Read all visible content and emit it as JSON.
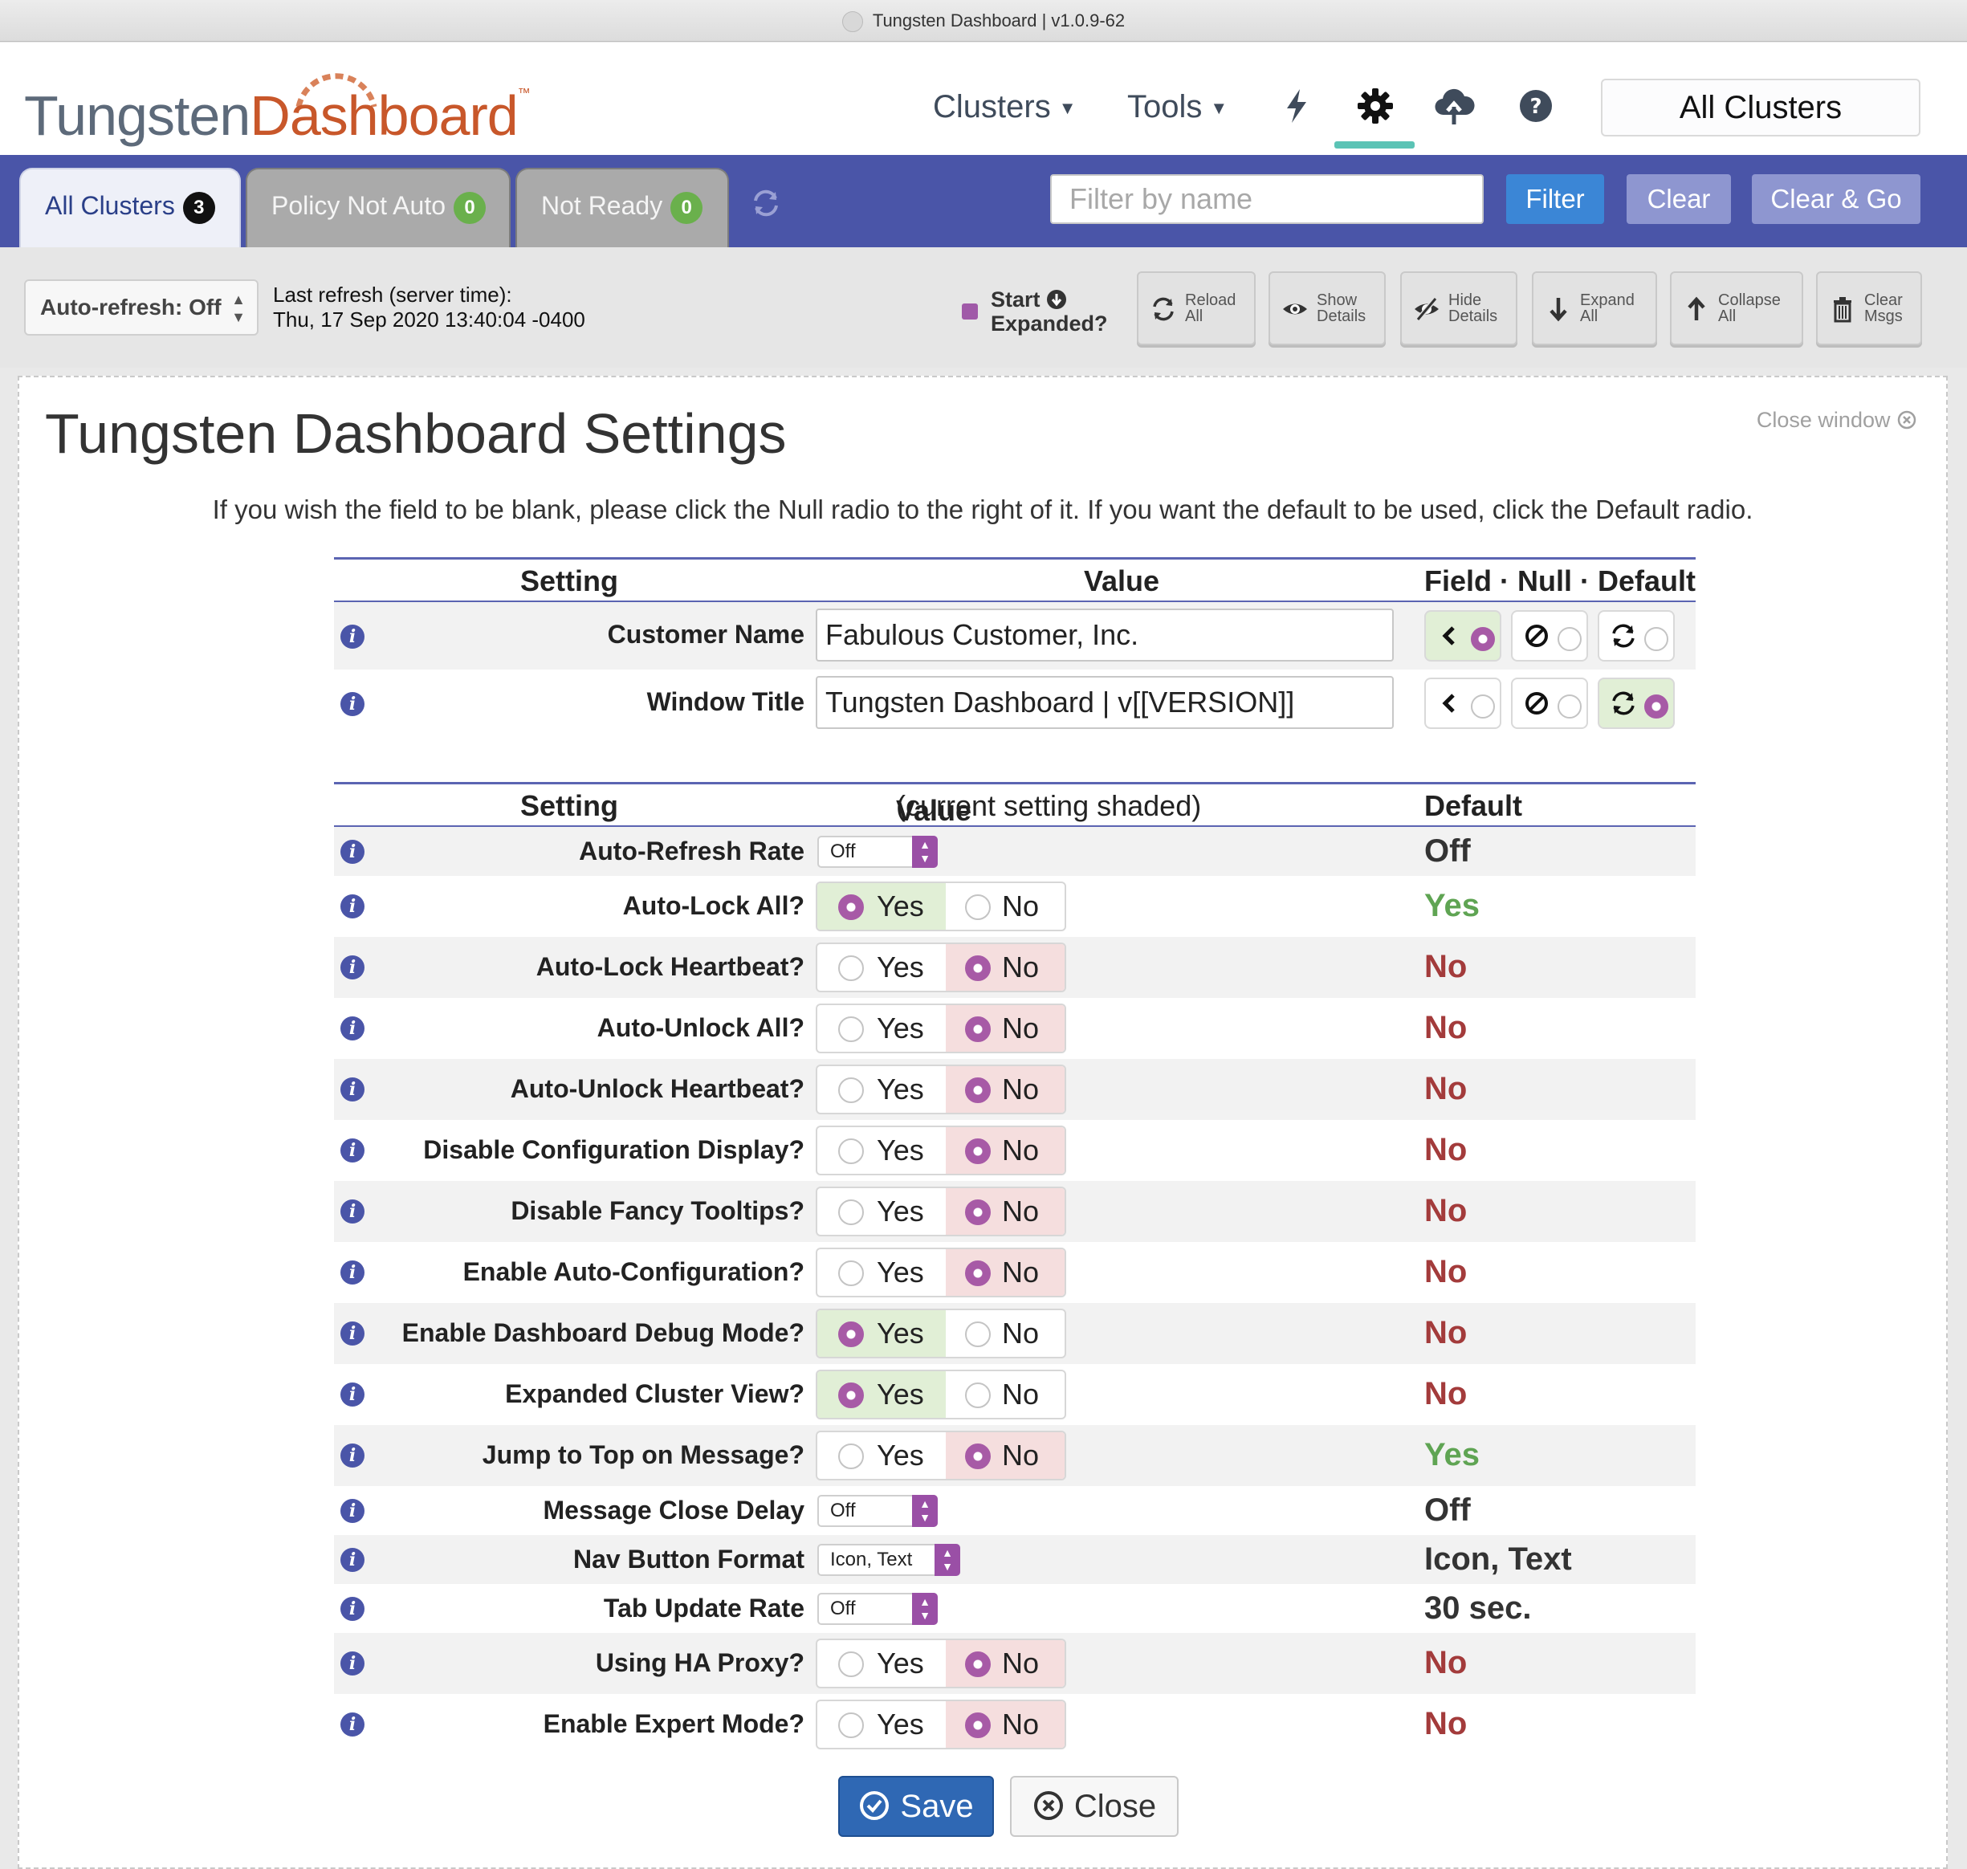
{
  "window": {
    "title": "Tungsten Dashboard | v1.0.9-62"
  },
  "header": {
    "logo_part1": "Tungsten",
    "logo_part2": "Dashboard",
    "logo_tm": "™",
    "nav": {
      "clusters": "Clusters",
      "tools": "Tools"
    },
    "icons": [
      "bolt-icon",
      "gear-icon",
      "cloud-upload-icon",
      "help-icon"
    ],
    "cluster_select": "All Clusters"
  },
  "tabs": [
    {
      "label": "All Clusters",
      "count": "3",
      "active": true
    },
    {
      "label": "Policy Not Auto",
      "count": "0",
      "active": false
    },
    {
      "label": "Not Ready",
      "count": "0",
      "active": false
    }
  ],
  "filter": {
    "placeholder": "Filter by name",
    "filter_label": "Filter",
    "clear_label": "Clear",
    "clear_go_label": "Clear & Go"
  },
  "toolbar": {
    "autorefresh": "Auto-refresh: Off",
    "last_refresh_label": "Last refresh (server time):",
    "last_refresh_value": "Thu, 17 Sep 2020 13:40:04 -0400",
    "start_expanded_1": "Start",
    "start_expanded_2": "Expanded?",
    "buttons": [
      {
        "l1": "Reload",
        "l2": "All"
      },
      {
        "l1": "Show",
        "l2": "Details"
      },
      {
        "l1": "Hide",
        "l2": "Details"
      },
      {
        "l1": "Expand",
        "l2": "All"
      },
      {
        "l1": "Collapse",
        "l2": "All"
      },
      {
        "l1": "Clear",
        "l2": "Msgs"
      }
    ]
  },
  "settings": {
    "title": "Tungsten Dashboard Settings",
    "close_window": "Close window",
    "instructions": "If you wish the field to be blank, please click the Null radio to the right of it. If you want the default to be used, click the Default radio.",
    "table1": {
      "h_setting": "Setting",
      "h_value": "Value",
      "h_fnd": "Field · Null · Default",
      "rows": [
        {
          "label": "Customer Name",
          "value": "Fabulous Customer, Inc.",
          "selected": "field"
        },
        {
          "label": "Window Title",
          "value": "Tungsten Dashboard | v[[VERSION]]",
          "selected": "default"
        }
      ]
    },
    "table2": {
      "h_setting": "Setting",
      "h_value": "Value",
      "h_value_note": " (current setting shaded)",
      "h_default": "Default",
      "rows": [
        {
          "label": "Auto-Refresh Rate",
          "type": "select",
          "value": "Off",
          "default": "Off"
        },
        {
          "label": "Auto-Lock All?",
          "type": "yn",
          "value": "Yes",
          "default": "Yes"
        },
        {
          "label": "Auto-Lock Heartbeat?",
          "type": "yn",
          "value": "No",
          "default": "No"
        },
        {
          "label": "Auto-Unlock All?",
          "type": "yn",
          "value": "No",
          "default": "No"
        },
        {
          "label": "Auto-Unlock Heartbeat?",
          "type": "yn",
          "value": "No",
          "default": "No"
        },
        {
          "label": "Disable Configuration Display?",
          "type": "yn",
          "value": "No",
          "default": "No"
        },
        {
          "label": "Disable Fancy Tooltips?",
          "type": "yn",
          "value": "No",
          "default": "No"
        },
        {
          "label": "Enable Auto-Configuration?",
          "type": "yn",
          "value": "No",
          "default": "No"
        },
        {
          "label": "Enable Dashboard Debug Mode?",
          "type": "yn",
          "value": "Yes",
          "default": "No"
        },
        {
          "label": "Expanded Cluster View?",
          "type": "yn",
          "value": "Yes",
          "default": "No"
        },
        {
          "label": "Jump to Top on Message?",
          "type": "yn",
          "value": "No",
          "default": "Yes"
        },
        {
          "label": "Message Close Delay",
          "type": "select",
          "value": "Off",
          "default": "Off"
        },
        {
          "label": "Nav Button Format",
          "type": "select",
          "value": "Icon, Text",
          "default": "Icon, Text"
        },
        {
          "label": "Tab Update Rate",
          "type": "select",
          "value": "Off",
          "default": "30 sec."
        },
        {
          "label": "Using HA Proxy?",
          "type": "yn",
          "value": "No",
          "default": "No"
        },
        {
          "label": "Enable Expert Mode?",
          "type": "yn",
          "value": "No",
          "default": "No"
        }
      ]
    },
    "yes_label": "Yes",
    "no_label": "No",
    "save_label": "Save",
    "close_label": "Close"
  },
  "colors": {
    "accent": "#4a55a8",
    "selected_green": "#e1efd6",
    "selected_red": "#f5dede",
    "radio": "#a75aa6"
  }
}
